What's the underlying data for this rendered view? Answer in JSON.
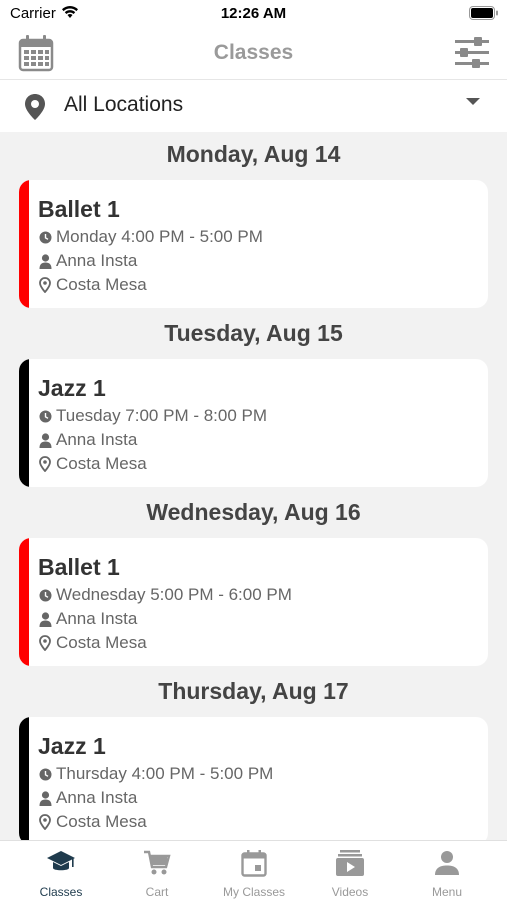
{
  "status_bar": {
    "carrier": "Carrier",
    "time": "12:26 AM"
  },
  "header": {
    "title": "Classes"
  },
  "location_filter": {
    "value": "All Locations"
  },
  "schedule": [
    {
      "day": "Monday, Aug 14",
      "class": {
        "name": "Ballet 1",
        "time": "Monday 4:00 PM - 5:00 PM",
        "instructor": "Anna Insta",
        "location": "Costa Mesa",
        "color": "#ff0000"
      }
    },
    {
      "day": "Tuesday, Aug 15",
      "class": {
        "name": "Jazz 1",
        "time": "Tuesday 7:00 PM - 8:00 PM",
        "instructor": "Anna Insta",
        "location": "Costa Mesa",
        "color": "#000000"
      }
    },
    {
      "day": "Wednesday, Aug 16",
      "class": {
        "name": "Ballet 1",
        "time": "Wednesday 5:00 PM - 6:00 PM",
        "instructor": "Anna Insta",
        "location": "Costa Mesa",
        "color": "#ff0000"
      }
    },
    {
      "day": "Thursday, Aug 17",
      "class": {
        "name": "Jazz 1",
        "time": "Thursday 4:00 PM - 5:00 PM",
        "instructor": "Anna Insta",
        "location": "Costa Mesa",
        "color": "#000000"
      }
    }
  ],
  "tabs": [
    {
      "label": "Classes",
      "icon": "graduation-cap-icon",
      "active": true
    },
    {
      "label": "Cart",
      "icon": "cart-icon",
      "active": false
    },
    {
      "label": "My Classes",
      "icon": "calendar-icon",
      "active": false
    },
    {
      "label": "Videos",
      "icon": "video-icon",
      "active": false
    },
    {
      "label": "Menu",
      "icon": "person-icon",
      "active": false
    }
  ],
  "colors": {
    "active_tab": "#1f3b4d",
    "inactive_tab": "#999999",
    "icon_gray": "#888888"
  }
}
